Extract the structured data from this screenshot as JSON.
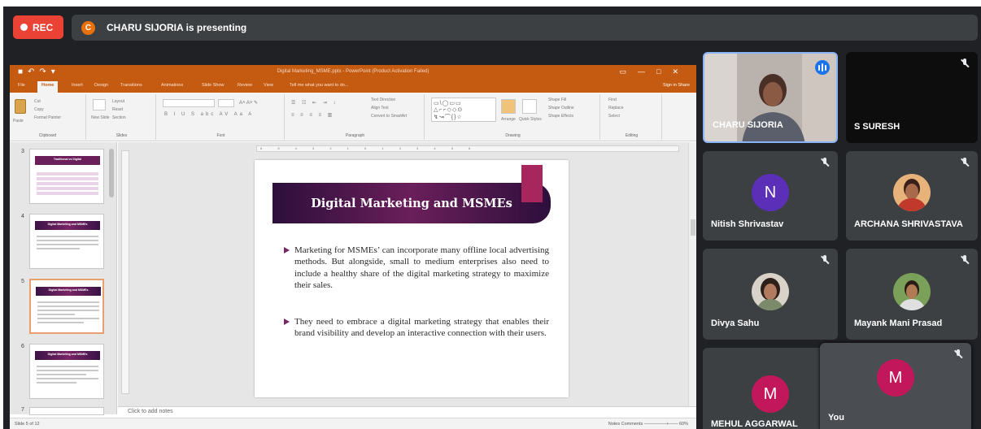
{
  "meet": {
    "rec_label": "REC",
    "presenter_initial": "C",
    "presenting_text": "CHARU SIJORIA is presenting"
  },
  "ppt": {
    "window_title": "Digital Marketing_MSME.pptx - PowerPoint (Product Activation Failed)",
    "tabs": [
      "File",
      "Home",
      "Insert",
      "Design",
      "Transitions",
      "Animations",
      "Slide Show",
      "Review",
      "View",
      "Tell me what you want to do..."
    ],
    "signin": "Sign in   Share",
    "ribbon_groups": [
      "Clipboard",
      "Slides",
      "Font",
      "Paragraph",
      "Drawing",
      "Editing"
    ],
    "ribbon_items": {
      "paste": "Paste",
      "cut": "Cut",
      "copy": "Copy",
      "format_painter": "Format Painter",
      "new_slide": "New Slide",
      "layout": "Layout",
      "reset": "Reset",
      "section": "Section",
      "text_direction": "Text Direction",
      "align_text": "Align Text",
      "convert_smartart": "Convert to SmartArt",
      "arrange": "Arrange",
      "quick_styles": "Quick Styles",
      "shape_fill": "Shape Fill",
      "shape_outline": "Shape Outline",
      "shape_effects": "Shape Effects",
      "find": "Find",
      "replace": "Replace",
      "select": "Select"
    },
    "thumbnails": [
      {
        "num": "3",
        "title": "Traditional vs Digital"
      },
      {
        "num": "4",
        "title": "Digital Marketing and MSMEs"
      },
      {
        "num": "5",
        "title": "Digital Marketing and MSMEs"
      },
      {
        "num": "6",
        "title": "Digital Marketing and MSMEs"
      },
      {
        "num": "7",
        "title": ""
      }
    ],
    "slide": {
      "title": "Digital Marketing and MSMEs",
      "bullets": [
        "Marketing for MSMEs’ can incorporate many offline local advertising methods. But alongside, small to medium enterprises also need to include a healthy share of the digital marketing strategy to maximize their sales.",
        "They need to embrace a digital marketing strategy that enables their brand visibility and develop an interactive connection with their users."
      ]
    },
    "notes_placeholder": "Click to add notes",
    "status_left": "Slide 5 of 12",
    "status_right": "Notes   Comments          —————+——  60%"
  },
  "participants": [
    {
      "name": "CHARU SIJORIA",
      "kind": "video",
      "speaking": true
    },
    {
      "name": "S SURESH",
      "kind": "blank",
      "muted": true
    },
    {
      "name": "Nitish Shrivastav",
      "kind": "letter",
      "letter": "N",
      "color": "#5b2fb8",
      "muted": true
    },
    {
      "name": "ARCHANA SHRIVASTAVA",
      "kind": "photo",
      "muted": true
    },
    {
      "name": "Divya Sahu",
      "kind": "photo",
      "muted": true
    },
    {
      "name": "Mayank Mani Prasad",
      "kind": "photo",
      "muted": true
    },
    {
      "name": "MEHUL AGGARWAL",
      "kind": "letter",
      "letter": "M",
      "color": "#c2185b"
    },
    {
      "name": "You",
      "kind": "letter",
      "letter": "M",
      "color": "#c2185b",
      "muted": true
    }
  ],
  "colors": {
    "meet_bg": "#202124",
    "tile_bg": "#3c4043",
    "rec_red": "#ea4335",
    "ppt_orange": "#c55a11",
    "slide_purple": "#6a1f5a",
    "accent_magenta": "#a8265e"
  }
}
